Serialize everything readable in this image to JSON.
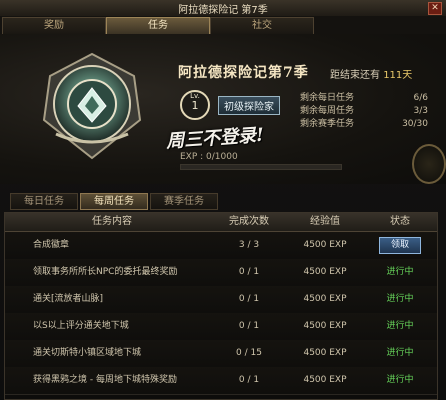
{
  "window": {
    "title": "阿拉德探险记 第7季",
    "close_icon": "close-icon"
  },
  "top_tabs": [
    {
      "label": "奖励"
    },
    {
      "label": "任务"
    },
    {
      "label": "社交"
    }
  ],
  "hero": {
    "season_title": "阿拉德探险记第7季",
    "days_left_prefix": "距结束还有",
    "days_left_value": "111天",
    "level_prefix": "Lv.",
    "level_value": "1",
    "rank_label": "初级探险家",
    "stats": [
      {
        "label": "剩余每日任务",
        "value": "6/6"
      },
      {
        "label": "剩余每周任务",
        "value": "3/3"
      },
      {
        "label": "剩余赛季任务",
        "value": "30/30"
      }
    ],
    "notice": "周三不登录!",
    "exp_label": "EXP : 0/1000",
    "exp_progress": 0
  },
  "sub_tabs": [
    {
      "label": "每日任务"
    },
    {
      "label": "每周任务"
    },
    {
      "label": "赛季任务"
    }
  ],
  "table": {
    "headers": [
      "任务内容",
      "完成次数",
      "经验值",
      "状态"
    ],
    "rows": [
      {
        "name": "合成徽章",
        "count": "3 / 3",
        "exp": "4500 EXP",
        "status": "领取",
        "claimable": true
      },
      {
        "name": "领取事务所所长NPC的委托最终奖励",
        "count": "0 / 1",
        "exp": "4500 EXP",
        "status": "进行中",
        "claimable": false
      },
      {
        "name": "通关[流放者山脉]",
        "count": "0 / 1",
        "exp": "4500 EXP",
        "status": "进行中",
        "claimable": false
      },
      {
        "name": "以S以上评分通关地下城",
        "count": "0 / 1",
        "exp": "4500 EXP",
        "status": "进行中",
        "claimable": false
      },
      {
        "name": "通关切斯特小镇区域地下城",
        "count": "0 / 15",
        "exp": "4500 EXP",
        "status": "进行中",
        "claimable": false
      },
      {
        "name": "获得黑鸦之境 - 每周地下城特殊奖励",
        "count": "0 / 1",
        "exp": "4500 EXP",
        "status": "进行中",
        "claimable": false
      }
    ]
  }
}
